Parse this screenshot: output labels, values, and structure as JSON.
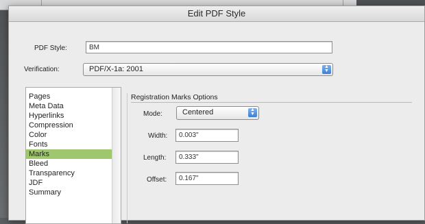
{
  "dialog": {
    "title": "Edit PDF Style"
  },
  "pdf_style": {
    "label": "PDF Style:",
    "value": "BM"
  },
  "verification": {
    "label": "Verification:",
    "value": "PDF/X-1a: 2001"
  },
  "sidebar": {
    "items": [
      {
        "label": "Pages"
      },
      {
        "label": "Meta Data"
      },
      {
        "label": "Hyperlinks"
      },
      {
        "label": "Compression"
      },
      {
        "label": "Color"
      },
      {
        "label": "Fonts"
      },
      {
        "label": "Marks",
        "selected": true
      },
      {
        "label": "Bleed"
      },
      {
        "label": "Transparency"
      },
      {
        "label": "JDF"
      },
      {
        "label": "Summary"
      }
    ]
  },
  "registration": {
    "title": "Registration Marks Options",
    "mode": {
      "label": "Mode:",
      "value": "Centered"
    },
    "width": {
      "label": "Width:",
      "value": "0.003\""
    },
    "length": {
      "label": "Length:",
      "value": "0.333\""
    },
    "offset": {
      "label": "Offset:",
      "value": "0.167\""
    }
  },
  "colors": {
    "selection": "#9fc76e",
    "popup_arrow": "#3f7fd3"
  },
  "icons": {
    "popup_arrows": "up-down-arrows-icon"
  }
}
